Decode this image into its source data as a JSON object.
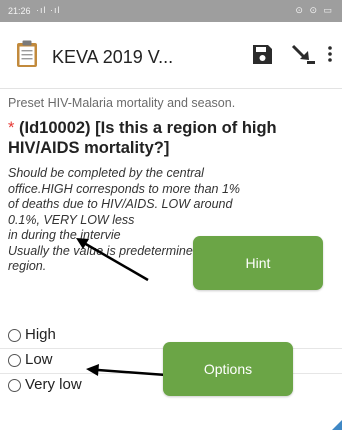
{
  "status_bar": {
    "time": "21:26",
    "signal": "·ıl ·ıl",
    "icons": "⊙ ⊙ ▭"
  },
  "app_bar": {
    "icons": [
      "clipboard-icon",
      "save-icon",
      "send-icon",
      "overflow-menu-icon"
    ],
    "title": "KEVA 2019 V..."
  },
  "form": {
    "preset_text": "Preset HIV-Malaria mortality and season.",
    "required_mark": "*",
    "question": "(Id10002) [Is this a region of high HIV/AIDS mortality?]",
    "hint_lines": [
      "Should be completed by the central",
      "office.HIGH corresponds to more than 1%",
      "of deaths due to HIV/AIDS. LOW around",
      "0.1%, VERY LOW less",
      "in during the intervie",
      "Usually the value is predetermined for the",
      "region."
    ],
    "options": [
      "High",
      "Low",
      "Very low"
    ]
  },
  "callouts": {
    "hint": "Hint",
    "options": "Options"
  },
  "colors": {
    "callout_green": "#6ba546",
    "required_red": "#e53935",
    "status_bar_gray": "#9e9e9e",
    "corner_blue": "#3f88c5"
  }
}
